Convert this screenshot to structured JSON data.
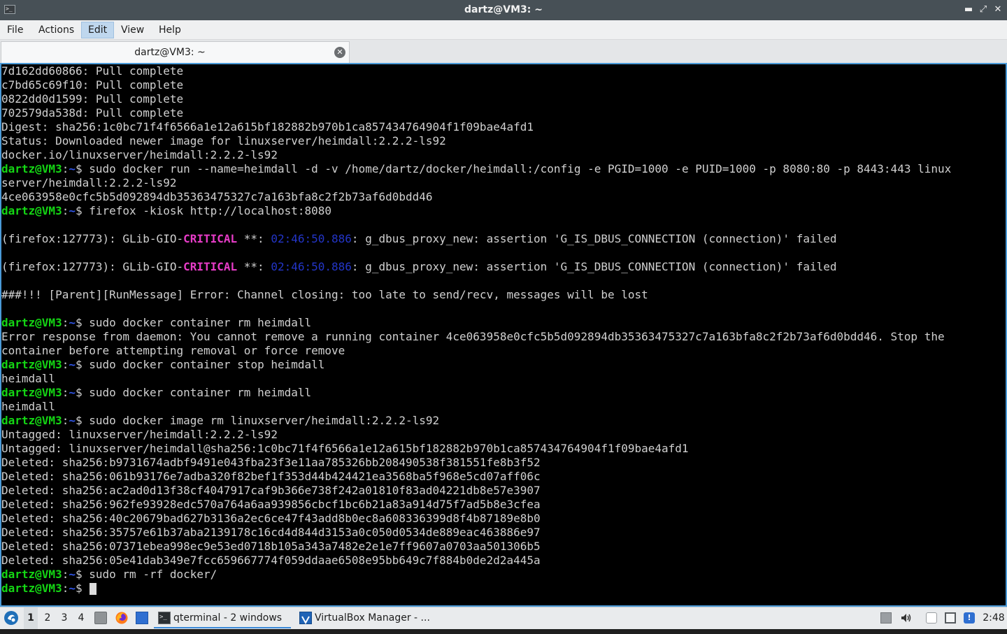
{
  "window": {
    "title": "dartz@VM3: ~",
    "controls": {
      "minimize": "▬",
      "maximize": "⤢",
      "close": "✕"
    }
  },
  "menu": [
    "File",
    "Actions",
    "Edit",
    "View",
    "Help"
  ],
  "active_menu": "Edit",
  "tab": {
    "label": "dartz@VM3: ~",
    "close_glyph": "✕"
  },
  "terminal": {
    "prompt": {
      "user": "dartz@VM3",
      "sep": ":",
      "path": "~",
      "symbol": "$ "
    },
    "lines": [
      {
        "text": "7d162dd60866: Pull complete"
      },
      {
        "text": "c7bd65c69f10: Pull complete"
      },
      {
        "text": "0822dd0d1599: Pull complete"
      },
      {
        "text": "702579da538d: Pull complete"
      },
      {
        "text": "Digest: sha256:1c0bc71f4f6566a1e12a615bf182882b970b1ca857434764904f1f09bae4afd1"
      },
      {
        "text": "Status: Downloaded newer image for linuxserver/heimdall:2.2.2-ls92"
      },
      {
        "text": "docker.io/linuxserver/heimdall:2.2.2-ls92"
      },
      {
        "prompt": true,
        "text": "sudo docker run --name=heimdall -d -v /home/dartz/docker/heimdall:/config -e PGID=1000 -e PUID=1000 -p 8080:80 -p 8443:443 linux"
      },
      {
        "text": "server/heimdall:2.2.2-ls92"
      },
      {
        "text": "4ce063958e0cfc5b5d092894db35363475327c7a163bfa8c2f2b73af6d0bdd46"
      },
      {
        "prompt": true,
        "text": "firefox -kiosk http://localhost:8080"
      },
      {
        "text": ""
      },
      {
        "glib": true,
        "pre": "(firefox:127773): GLib-GIO-",
        "crit": "CRITICAL",
        "mid": " **: ",
        "ts": "02:46:50.886",
        "post": ": g_dbus_proxy_new: assertion 'G_IS_DBUS_CONNECTION (connection)' failed"
      },
      {
        "text": ""
      },
      {
        "glib": true,
        "pre": "(firefox:127773): GLib-GIO-",
        "crit": "CRITICAL",
        "mid": " **: ",
        "ts": "02:46:50.886",
        "post": ": g_dbus_proxy_new: assertion 'G_IS_DBUS_CONNECTION (connection)' failed"
      },
      {
        "text": ""
      },
      {
        "text": "###!!! [Parent][RunMessage] Error: Channel closing: too late to send/recv, messages will be lost"
      },
      {
        "text": ""
      },
      {
        "prompt": true,
        "text": "sudo docker container rm heimdall"
      },
      {
        "text": "Error response from daemon: You cannot remove a running container 4ce063958e0cfc5b5d092894db35363475327c7a163bfa8c2f2b73af6d0bdd46. Stop the"
      },
      {
        "text": "container before attempting removal or force remove"
      },
      {
        "prompt": true,
        "text": "sudo docker container stop heimdall"
      },
      {
        "text": "heimdall"
      },
      {
        "prompt": true,
        "text": "sudo docker container rm heimdall"
      },
      {
        "text": "heimdall"
      },
      {
        "prompt": true,
        "text": "sudo docker image rm linuxserver/heimdall:2.2.2-ls92"
      },
      {
        "text": "Untagged: linuxserver/heimdall:2.2.2-ls92"
      },
      {
        "text": "Untagged: linuxserver/heimdall@sha256:1c0bc71f4f6566a1e12a615bf182882b970b1ca857434764904f1f09bae4afd1"
      },
      {
        "text": "Deleted: sha256:b9731674adbf9491e043fba23f3e11aa785326bb208490538f381551fe8b3f52"
      },
      {
        "text": "Deleted: sha256:061b93176e7adba320f82bef1f353d44b424421ea3568ba5f968e5cd07aff06c"
      },
      {
        "text": "Deleted: sha256:ac2ad0d13f38cf4047917caf9b366e738f242a01810f83ad04221db8e57e3907"
      },
      {
        "text": "Deleted: sha256:962fe93928edc570a764a6aa939856cbcf1bc6b21a83a914d75f7ad5b8e3cfea"
      },
      {
        "text": "Deleted: sha256:40c20679bad627b3136a2ec6ce47f43add8b0ec8a608336399d8f4b87189e8b0"
      },
      {
        "text": "Deleted: sha256:35757e61b37aba2139178c16cd4d844d3153a0c050d0534de889eac463886e97"
      },
      {
        "text": "Deleted: sha256:07371ebea998ec9e53ed0718b105a343a7482e2e1e7ff9607a0703aa501306b5"
      },
      {
        "text": "Deleted: sha256:05e41dab349e7fcc659667774f059ddaae6508e95bb649c7f884b0de2d2a445a"
      },
      {
        "prompt": true,
        "text": "sudo rm -rf docker/"
      },
      {
        "prompt": true,
        "text": "",
        "cursor": true
      }
    ]
  },
  "taskbar": {
    "workspaces": [
      "1",
      "2",
      "3",
      "4"
    ],
    "active_workspace": "1",
    "apps": [
      {
        "label": "qterminal - 2 windows",
        "icon": "terminal-icon",
        "active": true
      },
      {
        "label": "VirtualBox Manager - ...",
        "icon": "virtualbox-icon",
        "active": false
      }
    ],
    "clock": "2:48"
  },
  "colors": {
    "prompt_user": "#14d614",
    "prompt_path": "#2f55e8",
    "critical": "#e83cc8",
    "timestamp": "#2335c8",
    "terminal_bg": "#000000",
    "terminal_fg": "#d0d0d0",
    "focus_border": "#4a9ad8"
  }
}
